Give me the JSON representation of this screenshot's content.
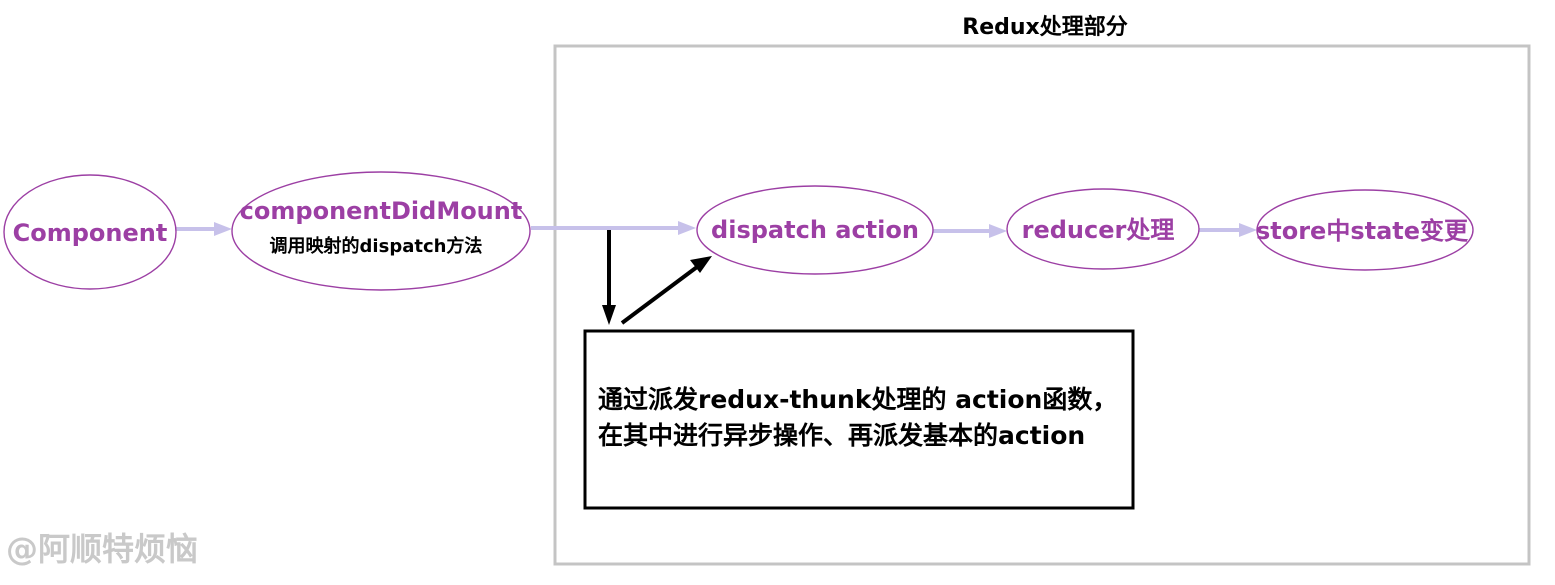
{
  "region": {
    "title": "Redux处理部分"
  },
  "nodes": {
    "component": {
      "label": "Component"
    },
    "componentDidMount": {
      "label": "componentDidMount",
      "sublabel": "调用映射的dispatch方法"
    },
    "dispatch_action": {
      "label": "dispatch action"
    },
    "reducer": {
      "label": "reducer处理"
    },
    "store": {
      "label": "store中state变更"
    }
  },
  "note": {
    "line1": "通过派发redux-thunk处理的 action函数，",
    "line2": "在其中进行异步操作、再派发基本的action"
  },
  "watermark": {
    "text": "@阿顺特烦恼"
  },
  "colors": {
    "node_text": "#9c3fa4",
    "node_border": "#9c3fa4",
    "flow_arrow": "#c7c1ea",
    "region_border": "#c4c4c4",
    "note_border": "#000000",
    "watermark": "#c9c9c9"
  }
}
